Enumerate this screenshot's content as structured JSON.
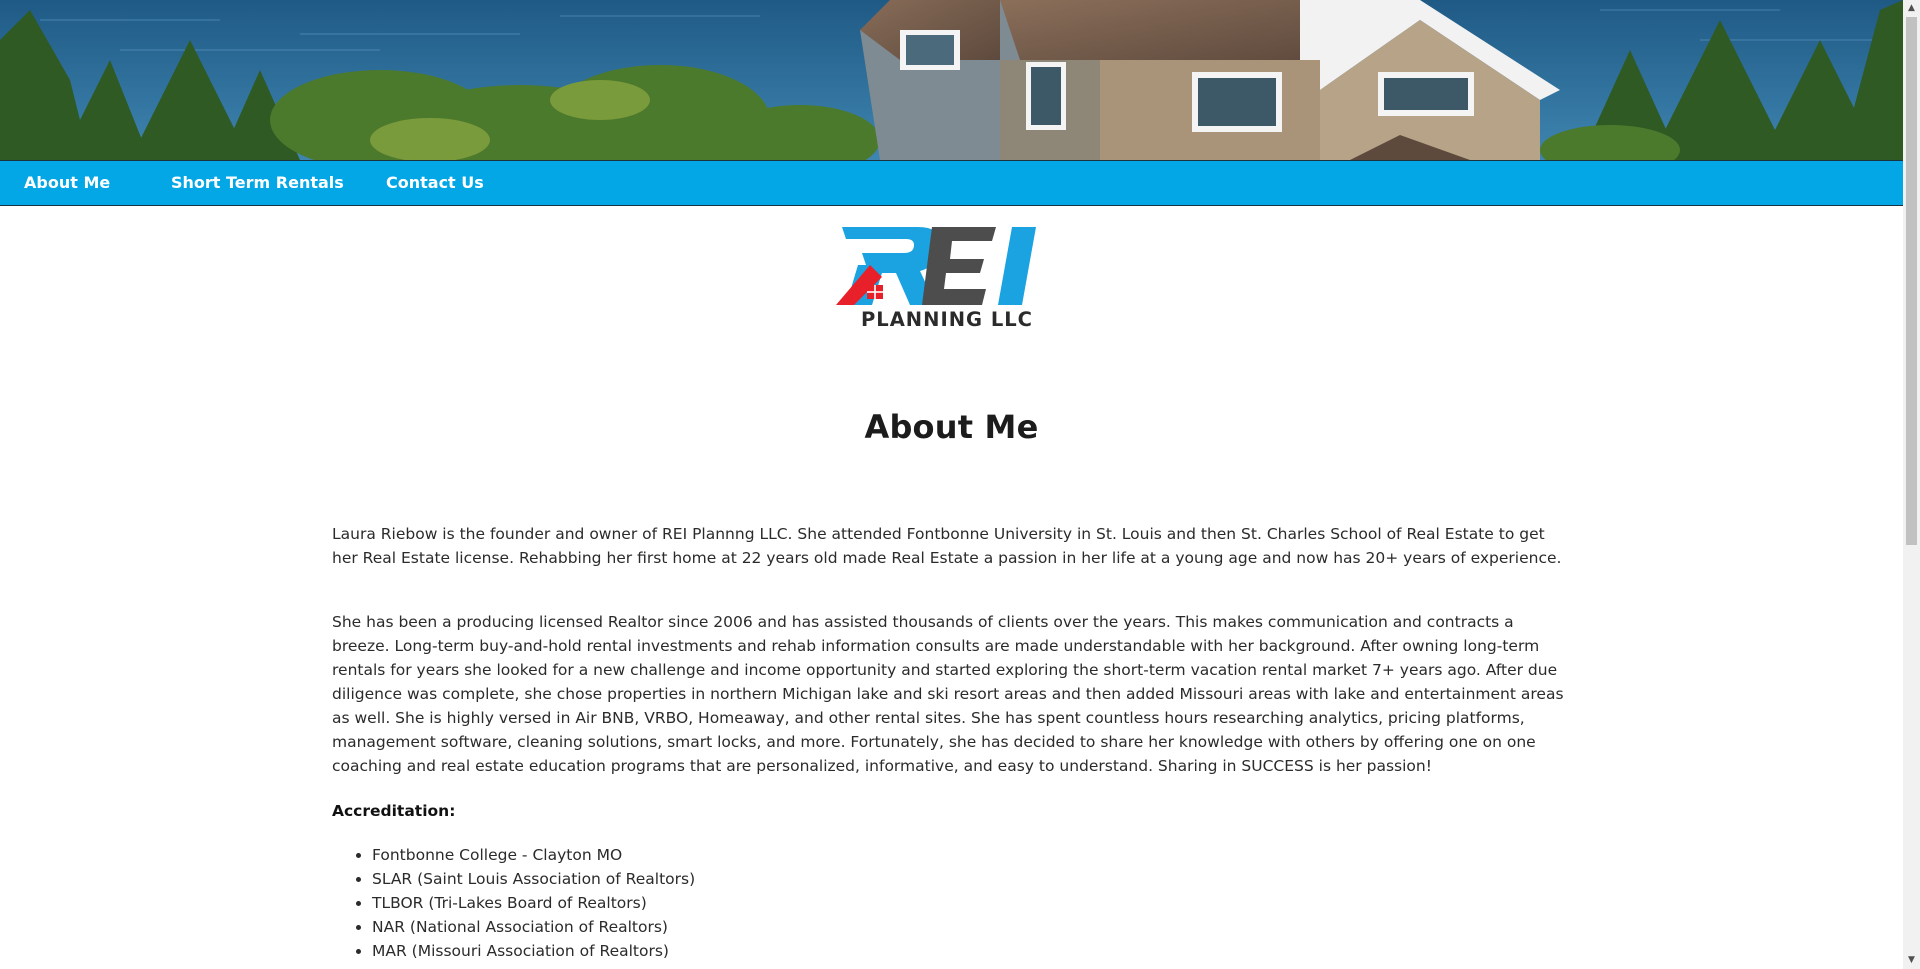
{
  "hero": {
    "alt": "Lakeside house banner"
  },
  "nav": {
    "items": [
      {
        "label": "About Me"
      },
      {
        "label": "Short Term Rentals"
      },
      {
        "label": "Contact Us"
      }
    ]
  },
  "logo": {
    "text_big": "REI",
    "text_small": "PLANNING LLC",
    "colors": {
      "blue": "#1aa3e0",
      "gray": "#4d4d4d",
      "red": "#e8202a",
      "dark": "#2b2b2b"
    }
  },
  "main": {
    "title": "About Me",
    "paragraph1": "Laura Riebow is the founder and owner of REI Plannng LLC. She attended Fontbonne University in St. Louis and then St. Charles School of Real Estate to get her Real Estate license. Rehabbing her first home at 22 years old made Real Estate a passion in her life at a young age and now has 20+ years of experience.",
    "paragraph2": "She has been a producing licensed Realtor since 2006 and has assisted thousands of clients over the years. This makes communication and contracts a breeze. Long-term buy-and-hold rental investments and rehab information consults are made understandable with her background. After owning long-term rentals for years she looked for a new challenge and income opportunity and started exploring the short-term vacation rental market 7+ years ago. After due diligence was complete, she chose properties in northern Michigan lake and ski resort areas and then added Missouri areas with lake and entertainment areas as well. She is highly versed in Air BNB, VRBO, Homeaway, and other rental sites. She has spent countless hours researching analytics, pricing platforms, management software, cleaning solutions, smart locks, and more. Fortunately, she has decided to share her knowledge with others by offering one on one coaching and real estate education programs that are personalized, informative, and easy to understand. Sharing in SUCCESS is her passion!",
    "accreditation_heading": "Accreditation:",
    "accreditations": [
      "Fontbonne College - Clayton MO",
      "SLAR (Saint Louis Association of Realtors)",
      "TLBOR (Tri-Lakes Board of Realtors)",
      "NAR (National Association of Realtors)",
      "MAR (Missouri Association of Realtors)"
    ]
  },
  "theme": {
    "nav_color": "#04a7e6"
  }
}
